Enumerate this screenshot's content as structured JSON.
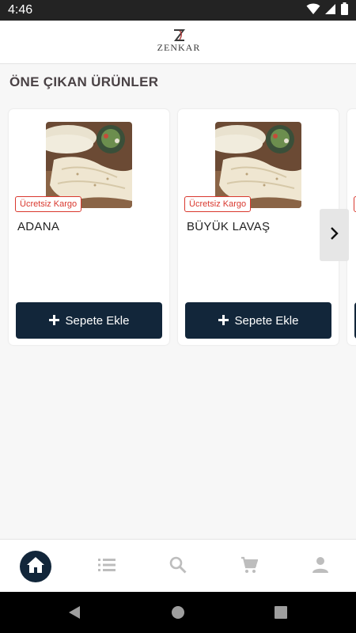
{
  "status_bar": {
    "time": "4:46",
    "icons": [
      "wifi-icon",
      "signal-icon",
      "battery-icon"
    ]
  },
  "header": {
    "brand_letter": "Z",
    "brand_name": "ZENKAR"
  },
  "section": {
    "title": "ÖNE ÇIKAN ÜRÜNLER"
  },
  "products": [
    {
      "name": "ADANA",
      "badge": "Ücretsiz Kargo",
      "button_label": "Sepete Ekle",
      "image": "lavash-bread-photo"
    },
    {
      "name": "BÜYÜK LAVAŞ",
      "badge": "Ücretsiz Kargo",
      "button_label": "Sepete Ekle",
      "image": "lavash-bread-photo"
    },
    {
      "name": "",
      "badge": "",
      "button_label": "",
      "image": ""
    }
  ],
  "bottom_nav": {
    "items": [
      {
        "name": "home",
        "icon": "home-icon",
        "active": true
      },
      {
        "name": "categories",
        "icon": "list-icon",
        "active": false
      },
      {
        "name": "search",
        "icon": "search-icon",
        "active": false
      },
      {
        "name": "cart",
        "icon": "cart-icon",
        "active": false
      },
      {
        "name": "profile",
        "icon": "person-icon",
        "active": false
      }
    ]
  },
  "colors": {
    "primary": "#12263a",
    "badge_red": "#d9382e",
    "title_text": "#4a4245",
    "background": "#f7f7f7"
  }
}
